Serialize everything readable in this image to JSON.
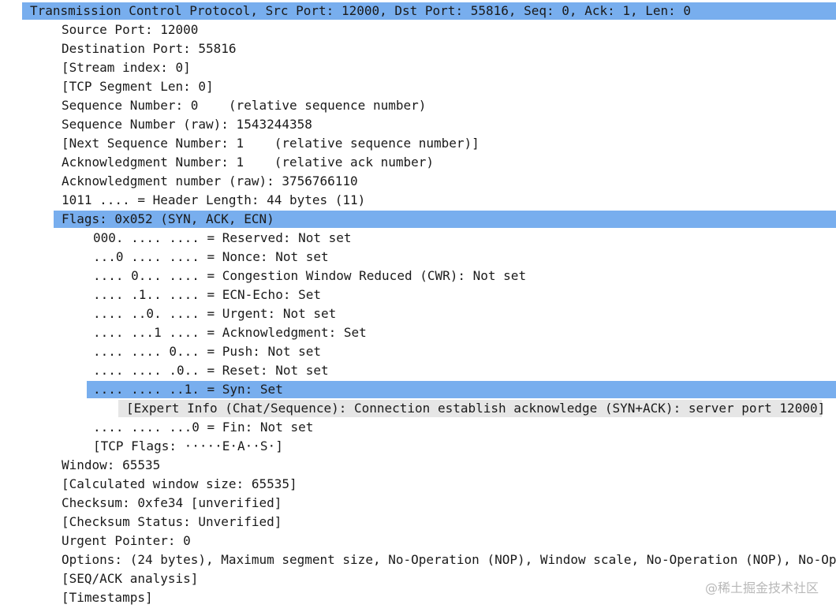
{
  "tcp_header": "Transmission Control Protocol, Src Port: 12000, Dst Port: 55816, Seq: 0, Ack: 1, Len: 0",
  "fields": {
    "source_port": "Source Port: 12000",
    "destination_port": "Destination Port: 55816",
    "stream_index": "[Stream index: 0]",
    "segment_len": "[TCP Segment Len: 0]",
    "seq_number": "Sequence Number: 0    (relative sequence number)",
    "seq_raw": "Sequence Number (raw): 1543244358",
    "next_seq": "[Next Sequence Number: 1    (relative sequence number)]",
    "ack_number": "Acknowledgment Number: 1    (relative ack number)",
    "ack_raw": "Acknowledgment number (raw): 3756766110",
    "header_length": "1011 .... = Header Length: 44 bytes (11)"
  },
  "flags": {
    "header": "Flags: 0x052 (SYN, ACK, ECN)",
    "reserved": "000. .... .... = Reserved: Not set",
    "nonce": "...0 .... .... = Nonce: Not set",
    "cwr": ".... 0... .... = Congestion Window Reduced (CWR): Not set",
    "ecn_echo": ".... .1.. .... = ECN-Echo: Set",
    "urgent": ".... ..0. .... = Urgent: Not set",
    "ack": ".... ...1 .... = Acknowledgment: Set",
    "push": ".... .... 0... = Push: Not set",
    "reset": ".... .... .0.. = Reset: Not set",
    "syn": ".... .... ..1. = Syn: Set",
    "expert_info": "[Expert Info (Chat/Sequence): Connection establish acknowledge (SYN+ACK): server port 12000]",
    "fin": ".... .... ...0 = Fin: Not set",
    "tcp_flags": "[TCP Flags: ·····E·A··S·]"
  },
  "more_fields": {
    "window": "Window: 65535",
    "calc_window": "[Calculated window size: 65535]",
    "checksum": "Checksum: 0xfe34 [unverified]",
    "checksum_status": "[Checksum Status: Unverified]",
    "urgent_pointer": "Urgent Pointer: 0",
    "options": "Options: (24 bytes), Maximum segment size, No-Operation (NOP), Window scale, No-Operation (NOP), No-Op",
    "seq_ack_analysis": "[SEQ/ACK analysis]",
    "timestamps": "[Timestamps]"
  },
  "watermark": "@稀土掘金技术社区",
  "colors": {
    "selection": "#78aeee",
    "expert_bg": "#e6e6e6",
    "triangle": "#6e6e6e"
  }
}
